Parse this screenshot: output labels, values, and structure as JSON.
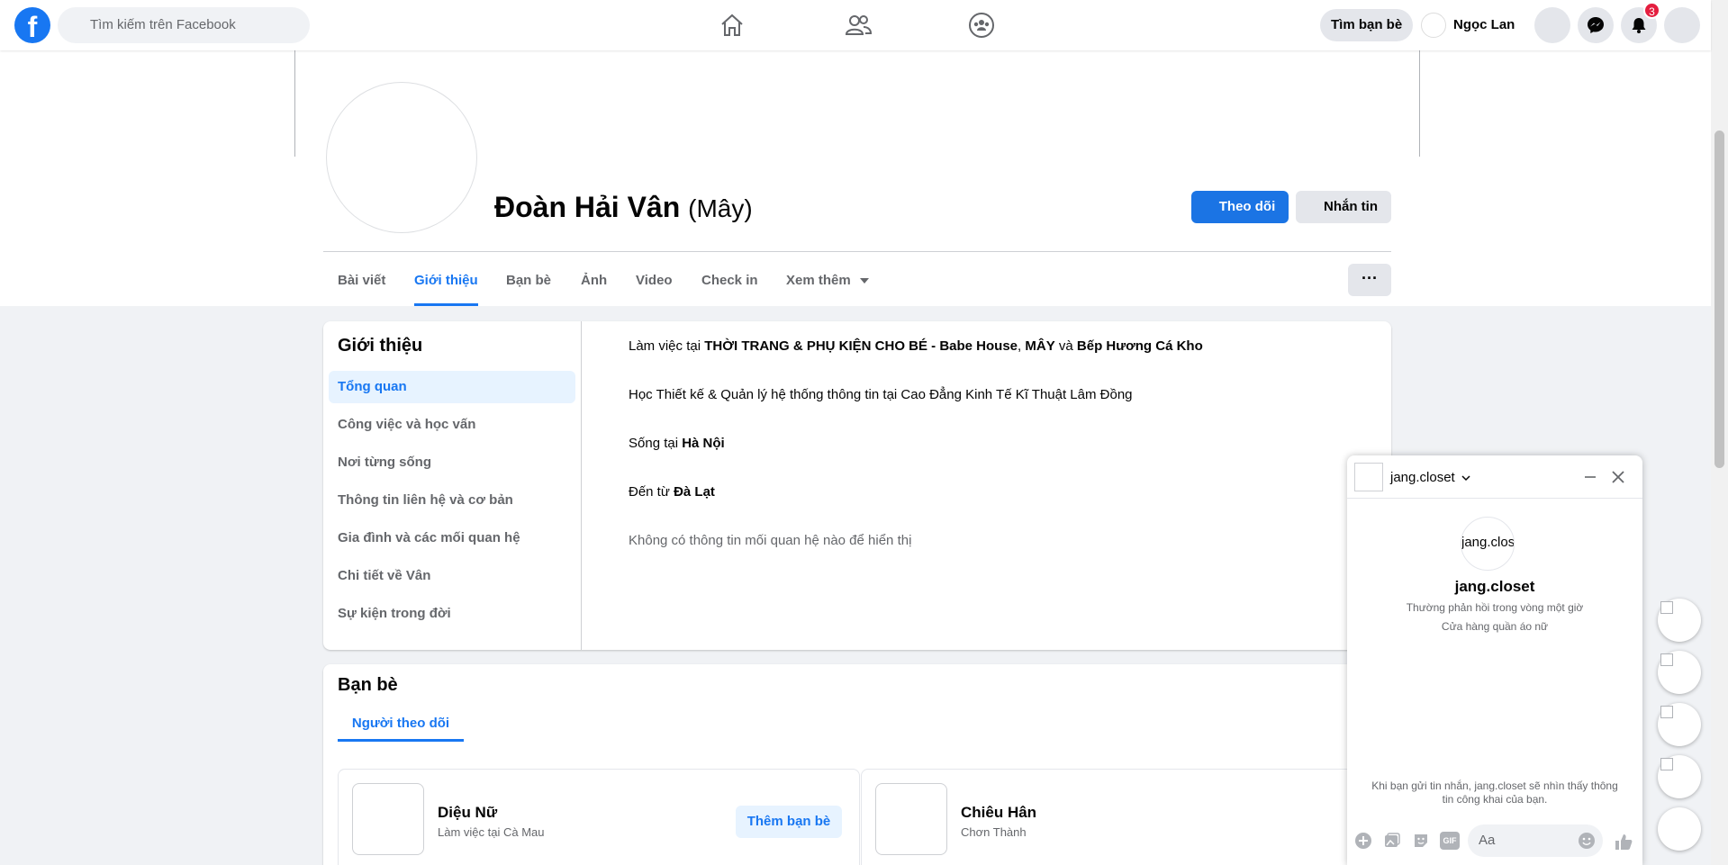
{
  "topbar": {
    "logo": "f",
    "search_placeholder": "Tìm kiếm trên Facebook",
    "find_friends": "Tìm bạn bè",
    "user_name": "Ngọc Lan",
    "notification_count": "3"
  },
  "profile": {
    "name": "Đoàn Hải Vân",
    "nickname": "(Mây)",
    "follow_label": "Theo dõi",
    "message_label": "Nhắn tin"
  },
  "tabs": [
    "Bài viết",
    "Giới thiệu",
    "Bạn bè",
    "Ảnh",
    "Video",
    "Check in",
    "Xem thêm"
  ],
  "more_label": "···",
  "intro": {
    "title": "Giới thiệu",
    "menu": [
      "Tổng quan",
      "Công việc và học vấn",
      "Nơi từng sống",
      "Thông tin liên hệ và cơ bản",
      "Gia đình và các mối quan hệ",
      "Chi tiết về Vân",
      "Sự kiện trong đời"
    ],
    "work_prefix": "Làm việc tại ",
    "work_1": "THỜI TRANG & PHỤ KIỆN CHO BÉ - Babe House",
    "work_sep": ", ",
    "work_2": "MÂY",
    "work_and": " và ",
    "work_3": "Bếp Hương  Cá Kho",
    "education": "Học Thiết kế & Quản lý hệ thống thông tin tại Cao Đẳng Kinh Tế Kĩ Thuật Lâm Đồng",
    "lives_prefix": "Sống tại ",
    "lives_in": "Hà Nội",
    "from_prefix": "Đến từ ",
    "from": "Đà Lạt",
    "relationship": "Không có thông tin mối quan hệ nào để hiển thị"
  },
  "friends": {
    "title": "Bạn bè",
    "tab": "Người theo dõi",
    "items": [
      {
        "name": "Diệu Nữ",
        "sub": "Làm việc tại Cà Mau",
        "action": "Thêm bạn bè"
      },
      {
        "name": "Chiêu Hân",
        "sub": "Chơn Thành"
      }
    ]
  },
  "chat": {
    "name": "jang.closet",
    "avatar_text": "jang.clos",
    "response": "Thường phản hồi trong vòng một giờ",
    "category": "Cửa hàng quần áo nữ",
    "notice": "Khi bạn gửi tin nhắn, jang.closet sẽ nhìn thấy thông tin công khai của bạn.",
    "input_placeholder": "Aa",
    "gif": "GIF"
  },
  "icons": {
    "home": "home-icon",
    "friends": "friends-icon",
    "groups": "groups-icon",
    "messenger": "messenger-icon",
    "bell": "bell-icon",
    "accent": "#1877f2"
  }
}
